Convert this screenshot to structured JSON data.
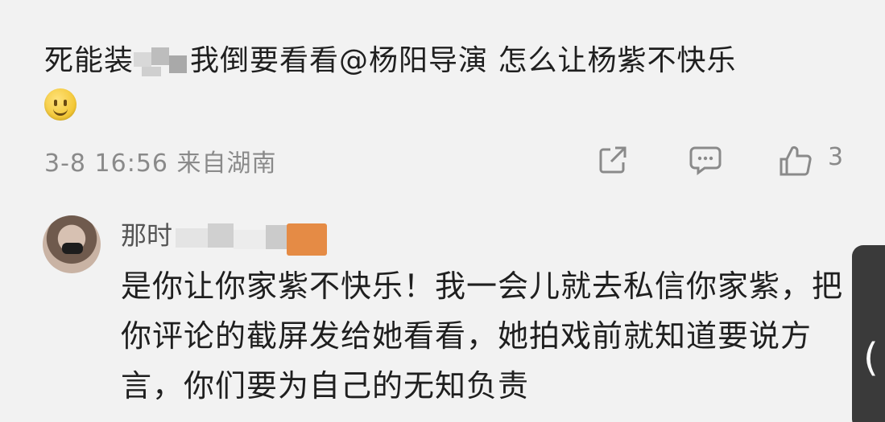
{
  "comment": {
    "text_before": "死能装",
    "text_after": "我倒要看看@杨阳导演 怎么让杨紫不快乐",
    "emoji": "smile-emoji"
  },
  "meta": {
    "timestamp": "3-8 16:56 来自湖南",
    "like_count": "3"
  },
  "reply": {
    "username": "那时",
    "text": "是你让你家紫不快乐！我一会儿就去私信你家紫，把你评论的截屏发给她看看，她拍戏前就知道要说方言，你们要为自己的无知负责"
  },
  "edge_tab": {
    "chevron": "("
  },
  "colors": {
    "background": "#f2f2f2",
    "text": "#1f1f1f",
    "meta": "#8a8a8a",
    "badge": "#e58b45"
  }
}
